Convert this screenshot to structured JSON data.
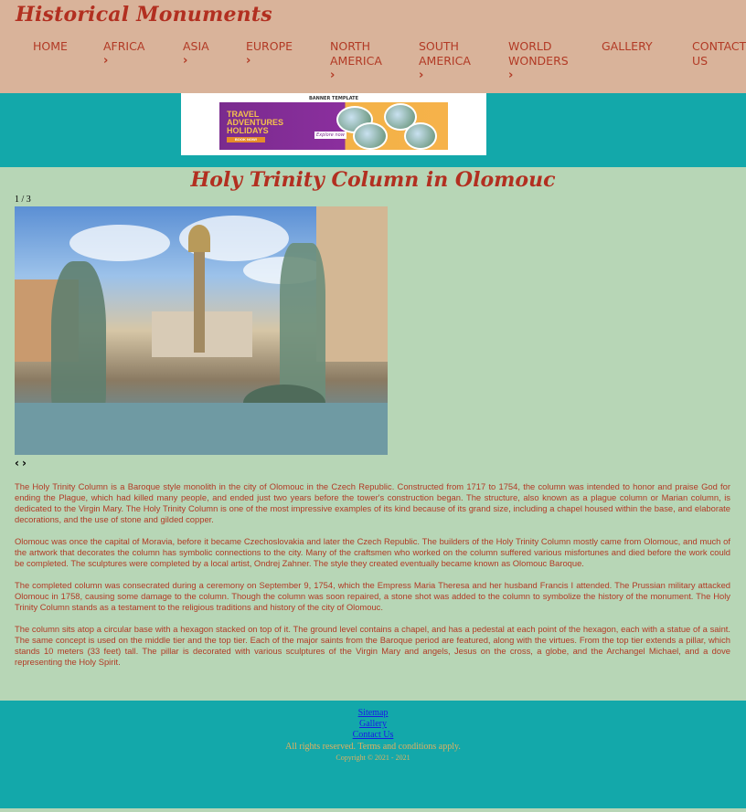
{
  "site": {
    "logo": "Historical Monuments"
  },
  "nav": {
    "home": "HOME",
    "africa": "AFRICA",
    "asia": "ASIA",
    "europe": "EUROPE",
    "north_america_1": "NORTH",
    "north_america_2": "AMERICA",
    "south_america_1": "SOUTH",
    "south_america_2": "AMERICA",
    "world_wonders_1": "WORLD",
    "world_wonders_2": "WONDERS",
    "gallery": "GALLERY",
    "contact_1": "CONTACT",
    "contact_2": "US",
    "chevron": "›"
  },
  "banner": {
    "template_label": "BANNER TEMPLATE",
    "line1": "TRAVEL",
    "line2": "ADVENTURES",
    "line3": "HOLIDAYS",
    "button": "BOOK NOW!",
    "explore": "Explore now"
  },
  "page": {
    "title": "Holy Trinity Column in Olomouc"
  },
  "slideshow": {
    "counter": "1 / 3",
    "prev": "‹",
    "next": "›"
  },
  "content": {
    "p1": "The Holy Trinity Column is a Baroque style monolith in the city of Olomouc in the Czech Republic. Constructed from 1717 to 1754, the column was intended to honor and praise God for ending the Plague, which had killed many people, and ended just two years before the tower's construction began. The structure, also known as a plague column or Marian column, is dedicated to the Virgin Mary. The Holy Trinity Column is one of the most impressive examples of its kind because of its grand size, including a chapel housed within the base, and elaborate decorations, and the use of stone and gilded copper.",
    "p2": "Olomouc was once the capital of Moravia, before it became Czechoslovakia and later the Czech Republic. The builders of the Holy Trinity Column mostly came from Olomouc, and much of the artwork that decorates the column has symbolic connections to the city. Many of the craftsmen who worked on the column suffered various misfortunes and died before the work could be completed. The sculptures were completed by a local artist, Ondrej Zahner. The style they created eventually became known as Olomouc Baroque.",
    "p3": "The completed column was consecrated during a ceremony on September 9, 1754, which the Empress Maria Theresa and her husband Francis I attended. The Prussian military attacked Olomouc in 1758, causing some damage to the column. Though the column was soon repaired, a stone shot was added to the column to symbolize the history of the monument. The Holy Trinity Column stands as a testament to the religious traditions and history of the city of Olomouc.",
    "p4": "The column sits atop a circular base with a hexagon stacked on top of it. The ground level contains a chapel, and has a pedestal at each point of the hexagon, each with a statue of a saint. The same concept is used on the middle tier and the top tier. Each of the major saints from the Baroque period are featured, along with the virtues. From the top tier extends a pillar, which stands 10 meters (33 feet) tall. The pillar is decorated with various sculptures of the Virgin Mary and angels, Jesus on the cross, a globe, and the Archangel Michael, and a dove representing the Holy Spirit."
  },
  "footer": {
    "sitemap": "Sitemap",
    "gallery": "Gallery",
    "contact": "Contact Us",
    "rights": "All rights reserved. Terms and conditions apply.",
    "copyright": "Copyright © 2021 - 2021"
  }
}
